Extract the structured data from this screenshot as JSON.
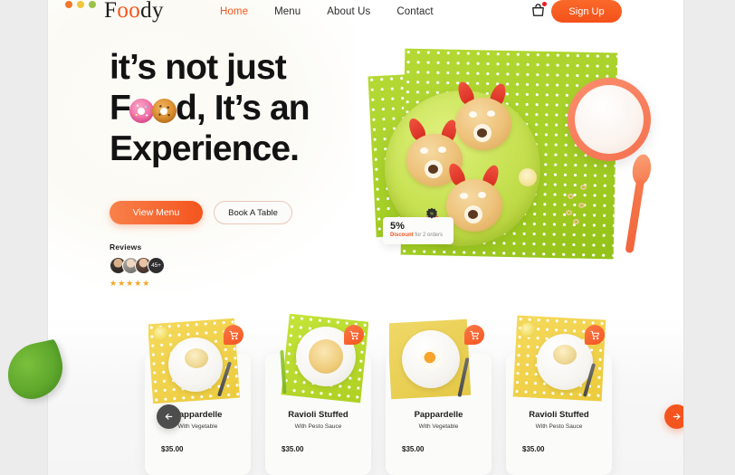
{
  "window": {
    "dots": [
      {
        "name": "dot-orange",
        "color": "#f4762a"
      },
      {
        "name": "dot-yellow",
        "color": "#f2c53d"
      },
      {
        "name": "dot-green",
        "color": "#9cc24a"
      }
    ]
  },
  "nav": {
    "logo": {
      "before": "F",
      "oo": "oo",
      "after": "dy",
      "full": "Foody"
    },
    "links": [
      {
        "label": "Home",
        "active": true
      },
      {
        "label": "Menu",
        "active": false
      },
      {
        "label": "About Us",
        "active": false
      },
      {
        "label": "Contact",
        "active": false
      }
    ],
    "cart_icon": "shopping-bag-icon",
    "cart_has_notification": true,
    "signup_label": "Sign Up",
    "accent_color": "#f4551e"
  },
  "hero": {
    "headline_line1": "it’s not just",
    "headline_line2_a": "F",
    "headline_line2_b": "d, It’s an",
    "headline_line3": "Experience.",
    "primary_cta": "View Menu",
    "secondary_cta": "Book A Table",
    "reviews": {
      "title": "Reviews",
      "more_count": "45+",
      "stars": "★★★★★",
      "star_color": "#f5a623"
    },
    "discount": {
      "percent": "5%",
      "label": "Discount",
      "suffix": " for 2 orders"
    }
  },
  "products": {
    "items": [
      {
        "name": "Pappardelle",
        "desc": "With Vegetable",
        "price": "$35.00",
        "cart_icon": "cart-icon"
      },
      {
        "name": "Ravioli Stuffed",
        "desc": "With Pesto Sauce",
        "price": "$35.00",
        "cart_icon": "cart-icon"
      },
      {
        "name": "Pappardelle",
        "desc": "With Vegetable",
        "price": "$35.00",
        "cart_icon": "cart-icon"
      },
      {
        "name": "Ravioli Stuffed",
        "desc": "With Pesto Sauce",
        "price": "$35.00",
        "cart_icon": "cart-icon"
      }
    ],
    "prev_icon": "arrow-left-icon",
    "next_icon": "arrow-right-icon"
  }
}
